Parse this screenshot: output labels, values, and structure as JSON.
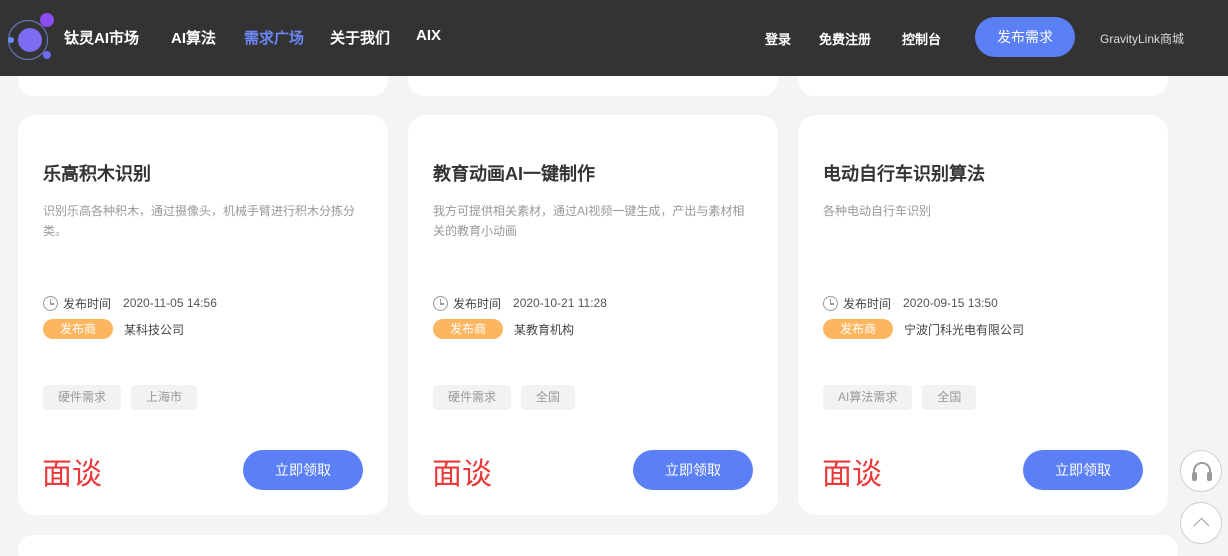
{
  "header": {
    "brand": "钛灵AI市场",
    "nav": [
      "AI算法",
      "需求广场",
      "关于我们",
      "AIX"
    ],
    "active_nav": "需求广场",
    "login": "登录",
    "register": "免费注册",
    "console": "控制台",
    "publish": "发布需求",
    "shop": "GravityLink商城"
  },
  "cards": [
    {
      "title": "乐高积木识别",
      "desc": "识别乐高各种积木，通过摄像头，机械手臂进行积木分拣分类。",
      "time_label": "发布时间",
      "time": "2020-11-05 14:56",
      "publisher_badge": "发布商",
      "publisher": "某科技公司",
      "tags": [
        "硬件需求",
        "上海市"
      ],
      "price": "面谈",
      "button": "立即领取"
    },
    {
      "title": "教育动画AI一键制作",
      "desc": "我方可提供相关素材，通过AI视频一键生成，产出与素材相关的教育小动画",
      "time_label": "发布时间",
      "time": "2020-10-21 11:28",
      "publisher_badge": "发布商",
      "publisher": "某教育机构",
      "tags": [
        "硬件需求",
        "全国"
      ],
      "price": "面谈",
      "button": "立即领取"
    },
    {
      "title": "电动自行车识别算法",
      "desc": "各种电动自行车识别",
      "time_label": "发布时间",
      "time": "2020-09-15 13:50",
      "publisher_badge": "发布商",
      "publisher": "宁波门科光电有限公司",
      "tags": [
        "AI算法需求",
        "全国"
      ],
      "price": "面谈",
      "button": "立即领取"
    }
  ],
  "colors": {
    "header_bg": "#333333",
    "accent": "#5b7ff5",
    "price": "#ea3a3a",
    "publisher_badge": "#fdb65f"
  },
  "floating": {
    "support_icon": "headset-icon",
    "top_icon": "chevron-up-icon"
  }
}
